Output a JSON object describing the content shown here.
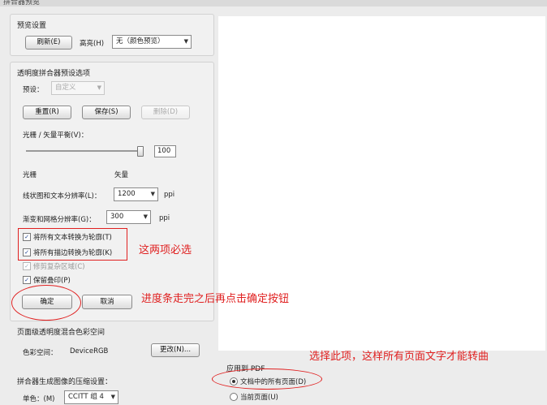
{
  "window": {
    "title": "拼合器预览"
  },
  "preset_settings": {
    "title": "预览设置",
    "refresh_label": "刷新(E)",
    "highlight_label": "高亮(H)",
    "highlight_value": "无（颜色预览）"
  },
  "transparency": {
    "title": "透明度拼合器预设选项",
    "preset_label": "预设：",
    "preset_value": "自定义",
    "reset_label": "重置(R)",
    "save_label": "保存(S)",
    "delete_label": "删除(D)",
    "balance_label": "光栅 / 矢量平衡(V)：",
    "balance_value": "100",
    "balance_fraction": 0.97,
    "raster_label": "光栅",
    "vector_label": "矢量",
    "line_res_label": "线状图和文本分辨率(L)：",
    "line_res_value": "1200",
    "line_res_unit": "ppi",
    "gradient_res_label": "渐变和网格分辨率(G)：",
    "gradient_res_value": "300",
    "gradient_res_unit": "ppi",
    "checkboxes": [
      {
        "label": "将所有文本转换为轮廓(T)",
        "checked": true,
        "disabled": false
      },
      {
        "label": "将所有描边转换为轮廓(K)",
        "checked": true,
        "disabled": false
      },
      {
        "label": "修剪复杂区域(C)",
        "checked": true,
        "disabled": true
      },
      {
        "label": "保留叠印(P)",
        "checked": true,
        "disabled": false
      }
    ]
  },
  "actions": {
    "ok_label": "确定",
    "cancel_label": "取消"
  },
  "page_blend": {
    "title": "页面级透明度混合色彩空间",
    "color_space_label": "色彩空间：",
    "color_space_value": "DeviceRGB",
    "change_label": "更改(N)..."
  },
  "compression": {
    "title": "拼合器生成图像的压缩设置：",
    "mono_label": "单色：(M)",
    "mono_value": "CCITT 组 4"
  },
  "apply_to": {
    "title": "应用到 PDF",
    "options": [
      {
        "label": "文档中的所有页面(D)",
        "selected": true
      },
      {
        "label": "当前页面(U)",
        "selected": false
      }
    ]
  },
  "annotations": {
    "checkbox_note": "这两项必选",
    "ok_note": "进度条走完之后再点击确定按钮",
    "apply_note": "选择此项，这样所有页面文字才能转曲"
  },
  "colors": {
    "annotation": "#e02020",
    "preview_bg": "#ffffff"
  }
}
